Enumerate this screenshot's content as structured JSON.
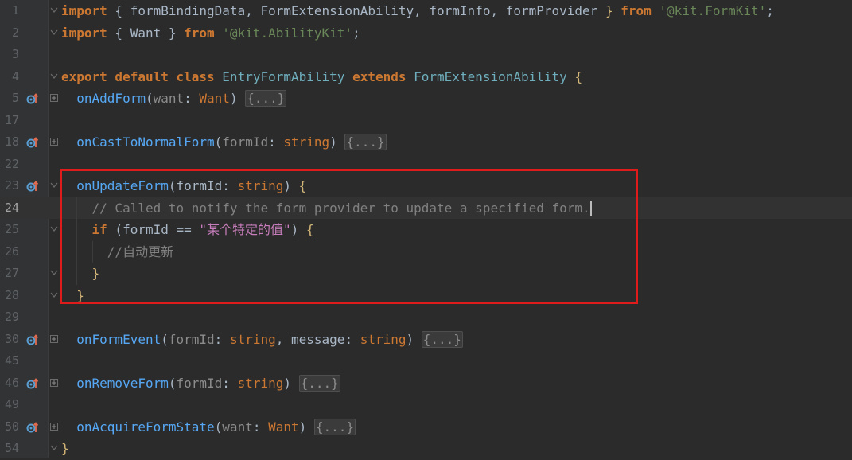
{
  "lines": [
    {
      "num": "1",
      "parts": [
        [
          "kw",
          "import"
        ],
        [
          "plain",
          " { "
        ],
        [
          "plain",
          "formBindingData"
        ],
        [
          "plain",
          ", "
        ],
        [
          "plain",
          "FormExtensionAbility"
        ],
        [
          "plain",
          ", "
        ],
        [
          "plain",
          "formInfo"
        ],
        [
          "plain",
          ", "
        ],
        [
          "plain",
          "formProvider"
        ],
        [
          "brace",
          " }"
        ],
        [
          "plain",
          " "
        ],
        [
          "kw",
          "from"
        ],
        [
          "plain",
          " "
        ],
        [
          "str",
          "'@kit.FormKit'"
        ],
        [
          "plain",
          ";"
        ]
      ]
    },
    {
      "num": "2",
      "parts": [
        [
          "kw",
          "import"
        ],
        [
          "plain",
          " { Want } "
        ],
        [
          "kw",
          "from"
        ],
        [
          "plain",
          " "
        ],
        [
          "str",
          "'@kit.AbilityKit'"
        ],
        [
          "plain",
          ";"
        ]
      ]
    },
    {
      "num": "3",
      "parts": []
    },
    {
      "num": "4",
      "parts": [
        [
          "kw",
          "export default class"
        ],
        [
          "plain",
          " "
        ],
        [
          "cls",
          "EntryFormAbility"
        ],
        [
          "plain",
          " "
        ],
        [
          "kw",
          "extends"
        ],
        [
          "plain",
          " "
        ],
        [
          "cls",
          "FormExtensionAbility"
        ],
        [
          "plain",
          " "
        ],
        [
          "brace",
          "{"
        ]
      ]
    },
    {
      "num": "5",
      "parts": [
        [
          "plain",
          "  "
        ],
        [
          "fn",
          "onAddForm"
        ],
        [
          "plain",
          "("
        ],
        [
          "param",
          "want"
        ],
        [
          "plain",
          ": "
        ],
        [
          "type",
          "Want"
        ],
        [
          "plain",
          ") "
        ],
        [
          "ellipsis",
          "{...}"
        ]
      ]
    },
    {
      "num": "17",
      "parts": []
    },
    {
      "num": "18",
      "parts": [
        [
          "plain",
          "  "
        ],
        [
          "fn",
          "onCastToNormalForm"
        ],
        [
          "plain",
          "("
        ],
        [
          "param",
          "formId"
        ],
        [
          "plain",
          ": "
        ],
        [
          "type",
          "string"
        ],
        [
          "plain",
          ") "
        ],
        [
          "ellipsis",
          "{...}"
        ]
      ]
    },
    {
      "num": "22",
      "parts": []
    },
    {
      "num": "23",
      "parts": [
        [
          "plain",
          "  "
        ],
        [
          "fn",
          "onUpdateForm"
        ],
        [
          "plain",
          "("
        ],
        [
          "plain",
          "formId"
        ],
        [
          "plain",
          ": "
        ],
        [
          "type",
          "string"
        ],
        [
          "plain",
          ") "
        ],
        [
          "brace",
          "{"
        ]
      ]
    },
    {
      "num": "24",
      "parts": [
        [
          "plain",
          "    "
        ],
        [
          "comment",
          "// Called to notify the form provider to update a specified form."
        ]
      ]
    },
    {
      "num": "25",
      "parts": [
        [
          "plain",
          "    "
        ],
        [
          "kw",
          "if"
        ],
        [
          "plain",
          " ("
        ],
        [
          "plain",
          "formId"
        ],
        [
          "plain",
          " == "
        ],
        [
          "str2",
          "\"某个特定的值\""
        ],
        [
          "plain",
          ") "
        ],
        [
          "brace",
          "{"
        ]
      ]
    },
    {
      "num": "26",
      "parts": [
        [
          "plain",
          "      "
        ],
        [
          "comment",
          "//自动更新"
        ]
      ]
    },
    {
      "num": "27",
      "parts": [
        [
          "plain",
          "    "
        ],
        [
          "brace",
          "}"
        ]
      ]
    },
    {
      "num": "28",
      "parts": [
        [
          "plain",
          "  "
        ],
        [
          "brace",
          "}"
        ]
      ]
    },
    {
      "num": "29",
      "parts": []
    },
    {
      "num": "30",
      "parts": [
        [
          "plain",
          "  "
        ],
        [
          "fn",
          "onFormEvent"
        ],
        [
          "plain",
          "("
        ],
        [
          "param",
          "formId"
        ],
        [
          "plain",
          ": "
        ],
        [
          "type",
          "string"
        ],
        [
          "plain",
          ", "
        ],
        [
          "plain",
          "message"
        ],
        [
          "plain",
          ": "
        ],
        [
          "type",
          "string"
        ],
        [
          "plain",
          ") "
        ],
        [
          "ellipsis",
          "{...}"
        ]
      ]
    },
    {
      "num": "45",
      "parts": []
    },
    {
      "num": "46",
      "parts": [
        [
          "plain",
          "  "
        ],
        [
          "fn",
          "onRemoveForm"
        ],
        [
          "plain",
          "("
        ],
        [
          "param",
          "formId"
        ],
        [
          "plain",
          ": "
        ],
        [
          "type",
          "string"
        ],
        [
          "plain",
          ") "
        ],
        [
          "ellipsis",
          "{...}"
        ]
      ]
    },
    {
      "num": "49",
      "parts": []
    },
    {
      "num": "50",
      "parts": [
        [
          "plain",
          "  "
        ],
        [
          "fn",
          "onAcquireFormState"
        ],
        [
          "plain",
          "("
        ],
        [
          "param",
          "want"
        ],
        [
          "plain",
          ": "
        ],
        [
          "type",
          "Want"
        ],
        [
          "plain",
          ") "
        ],
        [
          "ellipsis",
          "{...}"
        ]
      ]
    },
    {
      "num": "54",
      "parts": [
        [
          "brace",
          "}"
        ]
      ]
    }
  ],
  "override_icon_lines": [
    "5",
    "18",
    "23",
    "30",
    "46",
    "50"
  ],
  "current_line": "24",
  "colors": {
    "highlight": "#e01b1b",
    "background": "#2b2b2b"
  }
}
